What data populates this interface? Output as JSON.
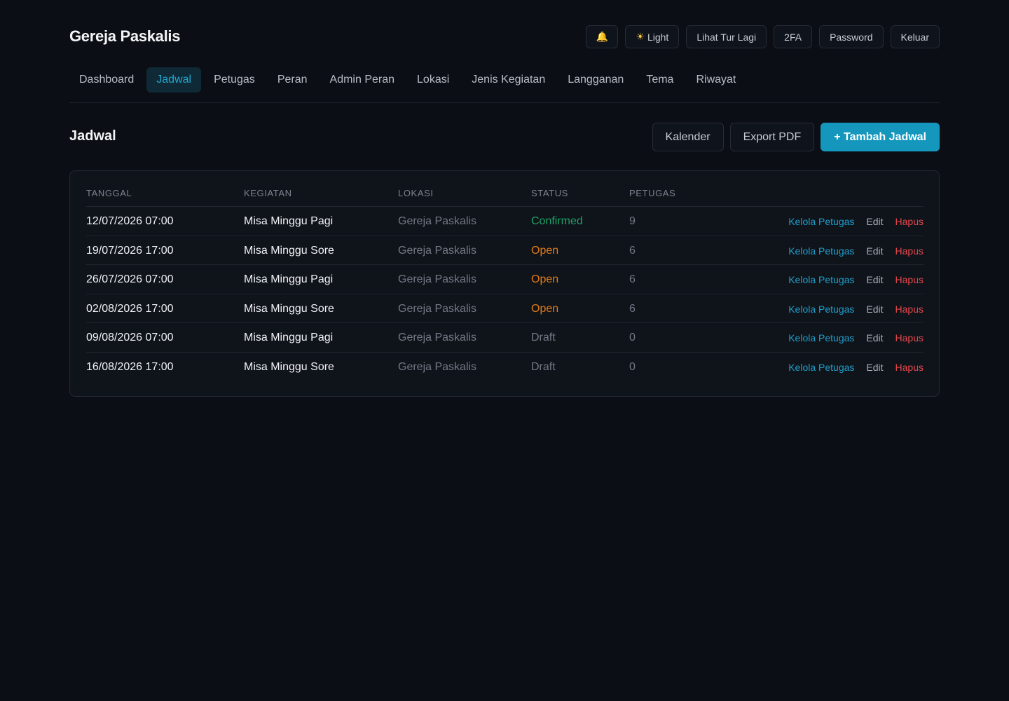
{
  "app": {
    "title": "Gereja Paskalis"
  },
  "header_buttons": {
    "bell_icon": "bell-icon",
    "theme_icon": "sun-icon",
    "theme_label": "Light",
    "tour_label": "Lihat Tur Lagi",
    "twofa_label": "2FA",
    "password_label": "Password",
    "logout_label": "Keluar"
  },
  "nav": {
    "items": [
      {
        "label": "Dashboard"
      },
      {
        "label": "Jadwal",
        "active": true
      },
      {
        "label": "Petugas"
      },
      {
        "label": "Peran"
      },
      {
        "label": "Admin Peran"
      },
      {
        "label": "Lokasi"
      },
      {
        "label": "Jenis Kegiatan"
      },
      {
        "label": "Langganan"
      },
      {
        "label": "Tema"
      },
      {
        "label": "Riwayat"
      }
    ]
  },
  "page": {
    "title": "Jadwal",
    "calendar_label": "Kalender",
    "export_label": "Export PDF",
    "add_label": "+ Tambah Jadwal"
  },
  "table": {
    "headers": {
      "tanggal": "TANGGAL",
      "kegiatan": "KEGIATAN",
      "lokasi": "LOKASI",
      "status": "STATUS",
      "petugas": "PETUGAS"
    },
    "actions": {
      "kelola": "Kelola Petugas",
      "edit": "Edit",
      "hapus": "Hapus"
    },
    "rows": [
      {
        "tanggal": "12/07/2026 07:00",
        "kegiatan": "Misa Minggu Pagi",
        "lokasi": "Gereja Paskalis",
        "status": "Confirmed",
        "petugas": "9"
      },
      {
        "tanggal": "19/07/2026 17:00",
        "kegiatan": "Misa Minggu Sore",
        "lokasi": "Gereja Paskalis",
        "status": "Open",
        "petugas": "6"
      },
      {
        "tanggal": "26/07/2026 07:00",
        "kegiatan": "Misa Minggu Pagi",
        "lokasi": "Gereja Paskalis",
        "status": "Open",
        "petugas": "6"
      },
      {
        "tanggal": "02/08/2026 17:00",
        "kegiatan": "Misa Minggu Sore",
        "lokasi": "Gereja Paskalis",
        "status": "Open",
        "petugas": "6"
      },
      {
        "tanggal": "09/08/2026 07:00",
        "kegiatan": "Misa Minggu Pagi",
        "lokasi": "Gereja Paskalis",
        "status": "Draft",
        "petugas": "0"
      },
      {
        "tanggal": "16/08/2026 17:00",
        "kegiatan": "Misa Minggu Sore",
        "lokasi": "Gereja Paskalis",
        "status": "Draft",
        "petugas": "0"
      }
    ]
  },
  "colors": {
    "background": "#0b0e14",
    "accent": "#1597bd",
    "status_confirmed": "#1fa268",
    "status_open": "#e07b17",
    "status_draft": "#737985",
    "danger": "#e5484d"
  }
}
